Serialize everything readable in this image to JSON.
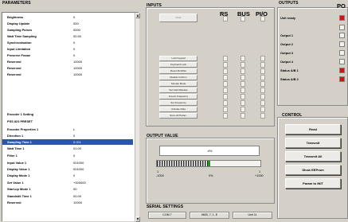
{
  "parameters": {
    "title": "PARAMETERS",
    "rows": [
      {
        "name": "Brightness",
        "value": "0",
        "selected": false
      },
      {
        "name": "Display Update",
        "value": "000",
        "selected": false
      },
      {
        "name": "Sampling Pulses",
        "value": "0000",
        "selected": false
      },
      {
        "name": "Wait Time Sampling",
        "value": "00.50",
        "selected": false
      },
      {
        "name": "Synchronisation",
        "value": "0",
        "selected": false
      },
      {
        "name": "Input Limitation",
        "value": "0",
        "selected": false
      },
      {
        "name": "Preserve Frame",
        "value": "0",
        "selected": false
      },
      {
        "name": "Reserved",
        "value": "10000",
        "selected": false
      },
      {
        "name": "Reserved",
        "value": "10000",
        "selected": false
      },
      {
        "name": "Reserved",
        "value": "10000",
        "selected": false
      },
      {
        "name": "",
        "value": "",
        "selected": false
      },
      {
        "name": "Encoder 1 Setting",
        "value": "",
        "selected": false
      },
      {
        "name": "PSS 823 PRESET",
        "value": "",
        "selected": false
      },
      {
        "name": "Encoder Properties 1",
        "value": "L",
        "selected": false
      },
      {
        "name": "Direction 1",
        "value": "0",
        "selected": false
      },
      {
        "name": "Sampling Time 1",
        "value": "0.001",
        "selected": true
      },
      {
        "name": "Wait Time 1",
        "value": "01.00",
        "selected": false
      },
      {
        "name": "Filter 1",
        "value": "0",
        "selected": false
      },
      {
        "name": "Input Value 1",
        "value": "001000",
        "selected": false
      },
      {
        "name": "Display Value 1",
        "value": "001000",
        "selected": false
      },
      {
        "name": "Display Mode 1",
        "value": "0",
        "selected": false
      },
      {
        "name": "Set Value 1",
        "value": "+000000",
        "selected": false
      },
      {
        "name": "Start-up Mode 1",
        "value": "00",
        "selected": false
      },
      {
        "name": "Standstill Time 1",
        "value": "00.00",
        "selected": false
      },
      {
        "name": "Reserved",
        "value": "10000",
        "selected": false
      }
    ]
  },
  "inputs": {
    "title": "INPUTS",
    "columns": [
      "RS",
      "BUS",
      "PI/O"
    ],
    "top_button": "Clear",
    "buttons": [
      "Lock Keypad",
      "Keyboard Lock",
      "Reset Min/Max",
      "Disable Uniform",
      "Sample Mode",
      "Sel Hold Release",
      "Freeze Frequency",
      "Set Frequency",
      "Activate Data",
      "Store All Param."
    ]
  },
  "output_value": {
    "title": "OUTPUT VALUE",
    "value": ".4%",
    "progress_fraction": 0.5,
    "scale_min": "-1000",
    "scale_mid": "0%",
    "scale_max": "+1000",
    "tick_left": "1",
    "tick_right": "1"
  },
  "serial_settings": {
    "title": "SERIAL SETTINGS",
    "port": "COM 7",
    "format": "9600, 7, 1, E",
    "address": "Unit 11"
  },
  "outputs": {
    "title": "OUTPUTS",
    "column": "PO",
    "items": [
      {
        "label": "Unit ready",
        "on": true
      },
      {
        "label": "",
        "on": false
      },
      {
        "label": "Output 1",
        "on": false
      },
      {
        "label": "Output 2",
        "on": false
      },
      {
        "label": "Output 3",
        "on": false
      },
      {
        "label": "Output 4",
        "on": false
      },
      {
        "label": "Status A/B 1",
        "on": true
      },
      {
        "label": "Status A/B 2",
        "on": true
      }
    ]
  },
  "control": {
    "title": "CONTROL",
    "buttons": [
      "Read",
      "Transmit",
      "Transmit All",
      "Show EEProm",
      "Param to INIT"
    ]
  }
}
